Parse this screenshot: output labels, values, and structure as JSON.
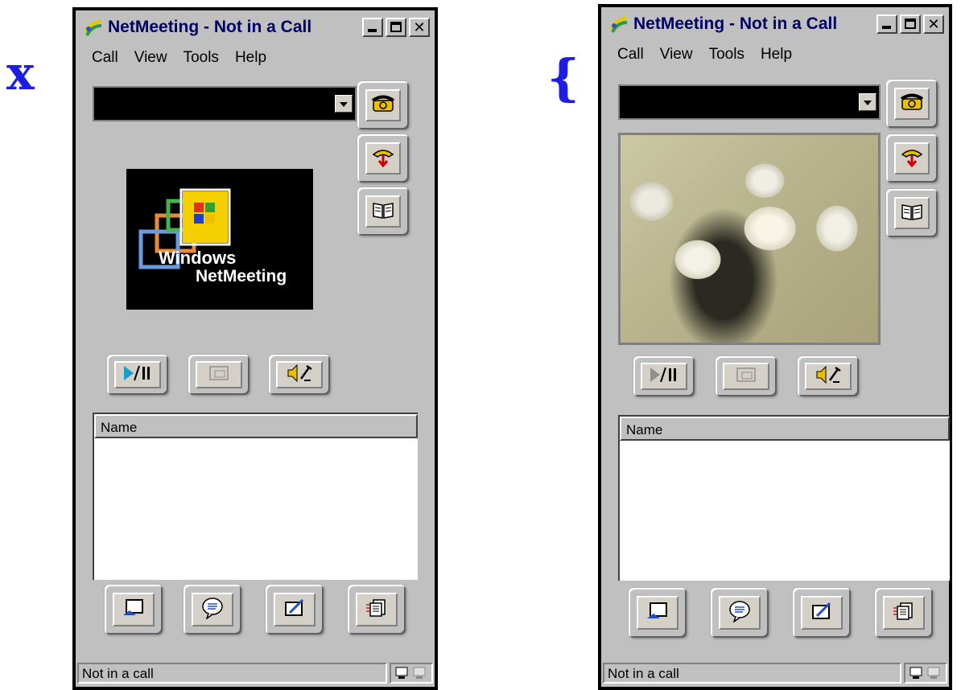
{
  "labels": {
    "left": "x",
    "right": "{"
  },
  "windows": [
    {
      "title": "NetMeeting - Not in a Call",
      "menu": [
        "Call",
        "View",
        "Tools",
        "Help"
      ],
      "video": "windows-netmeeting-logo",
      "logo_text": {
        "line1": "Windows",
        "line2": "NetMeeting"
      },
      "list_header": "Name",
      "status": "Not in a call"
    },
    {
      "title": "NetMeeting - Not in a Call",
      "menu": [
        "Call",
        "View",
        "Tools",
        "Help"
      ],
      "video": "flower-bouquet-photo",
      "list_header": "Name",
      "status": "Not in a call"
    }
  ],
  "icons": {
    "place_call": "phone-icon",
    "end_call": "hang-up-icon",
    "directory": "address-book-icon",
    "play_pause": "play-pause-icon",
    "picture_in_picture": "picture-in-picture-icon",
    "audio_tuning": "speaker-mic-icon",
    "share": "share-program-icon",
    "chat": "chat-bubble-icon",
    "whiteboard": "whiteboard-icon",
    "transfer": "file-transfer-icon"
  },
  "colors": {
    "label": "#1c1ce6",
    "window_face": "#c0c0c0",
    "title_text": "#000066",
    "video_background": "#000000"
  }
}
